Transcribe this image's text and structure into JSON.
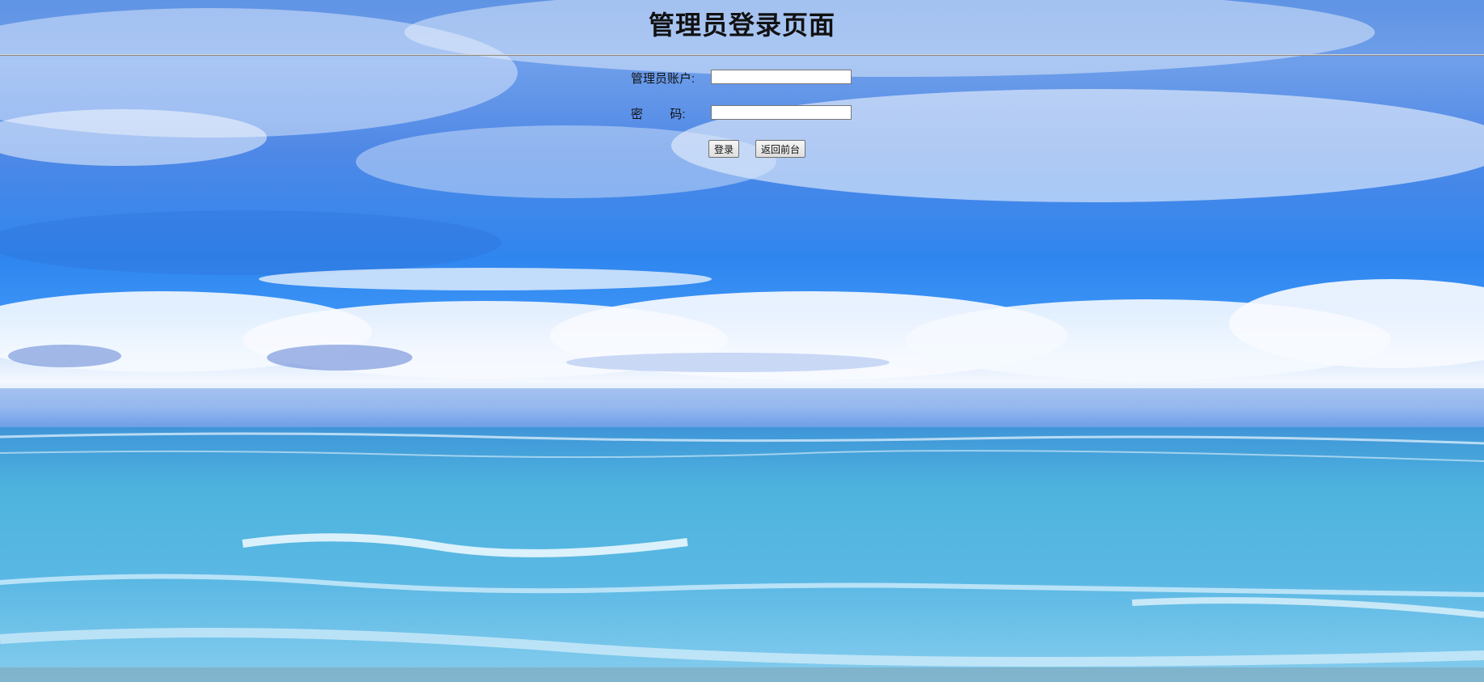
{
  "page": {
    "title": "管理员登录页面"
  },
  "form": {
    "account_label": "管理员账户:",
    "account_value": "",
    "password_label": "密        码:",
    "password_value": "",
    "login_button": "登录",
    "back_button": "返回前台"
  },
  "background": {
    "icon": "sky-and-sea-background-image"
  }
}
